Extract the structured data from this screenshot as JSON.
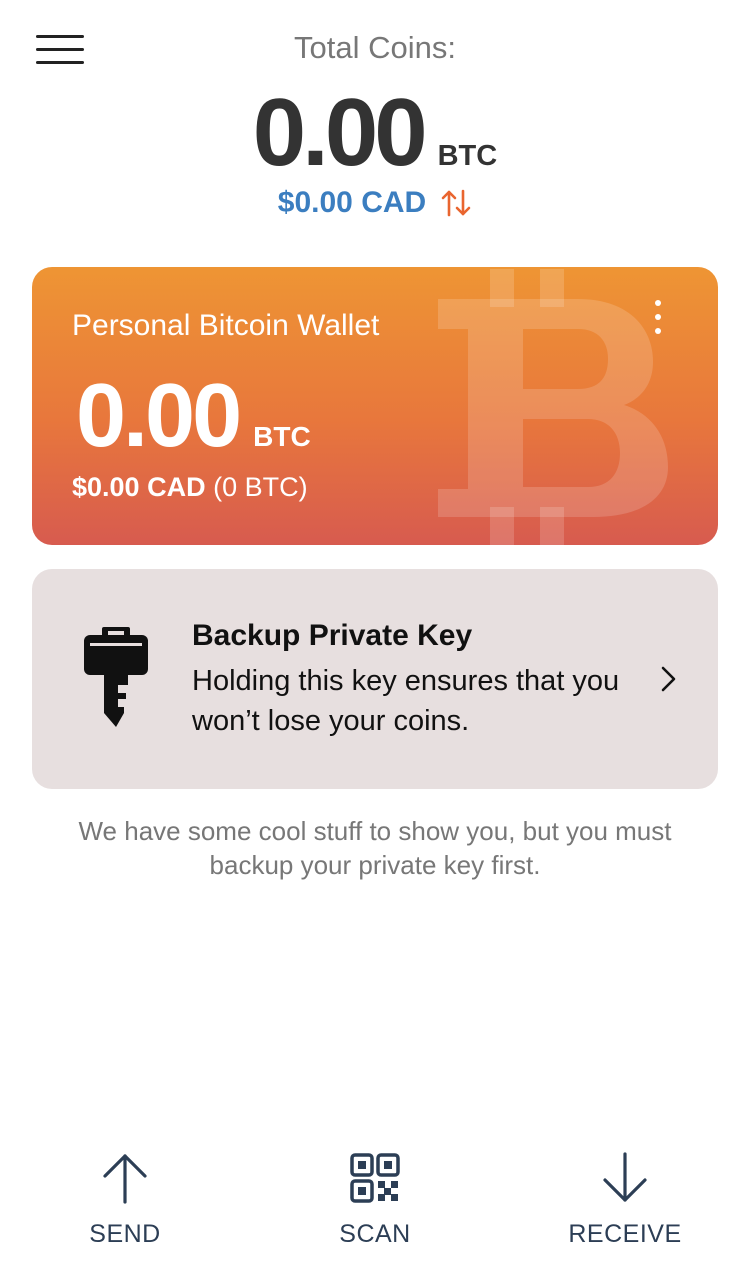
{
  "header": {
    "total_label": "Total Coins:",
    "total_amount": "0.00",
    "total_unit": "BTC",
    "fiat_value": "$0.00 CAD",
    "swap_icon": "swap-arrows-icon",
    "menu_icon": "hamburger-menu-icon"
  },
  "wallet": {
    "name": "Personal Bitcoin Wallet",
    "amount": "0.00",
    "unit": "BTC",
    "fiat_value": "$0.00 CAD",
    "fiat_sub": "(0 BTC)",
    "menu_icon": "more-vertical-icon",
    "background_icon": "bitcoin-icon"
  },
  "backup": {
    "title": "Backup Private Key",
    "description": "Holding this key ensures that you won’t lose your coins.",
    "icon": "key-icon",
    "chevron_icon": "chevron-right-icon"
  },
  "info_text": "We have some cool stuff to show you, but you must backup your private key first.",
  "bottom_nav": {
    "send_label": "SEND",
    "scan_label": "SCAN",
    "receive_label": "RECEIVE"
  },
  "colors": {
    "fiat_blue": "#3b7ec0",
    "swap_orange": "#e9652f",
    "card_gradient_top": "#ee9534",
    "card_gradient_bottom": "#d75b4f",
    "backup_bg": "#e7dfdf",
    "nav_dark": "#2c3e55"
  }
}
